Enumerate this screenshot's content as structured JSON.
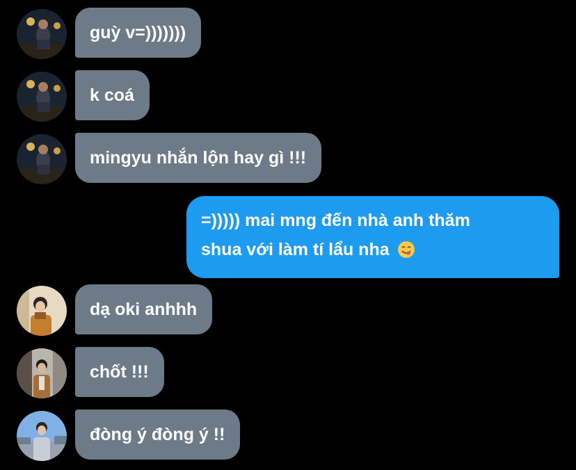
{
  "conversation": {
    "messages": [
      {
        "sender": "incoming",
        "avatar_icon": "avatar-night-photo-icon",
        "text": "guỳ v=)))))))"
      },
      {
        "sender": "incoming",
        "avatar_icon": "avatar-night-photo-icon",
        "text": "k coá"
      },
      {
        "sender": "incoming",
        "avatar_icon": "avatar-night-photo-icon",
        "text": "mingyu nhắn lộn hay gì !!!"
      },
      {
        "sender": "outgoing",
        "line1": "=))))) mai mng đến nhà anh thăm",
        "line2": "shua với làm tí lẩu nha",
        "emoji": "savoring-food-face-emoji"
      },
      {
        "sender": "incoming",
        "avatar_icon": "avatar-portrait-icon",
        "text": "dạ oki anhhh"
      },
      {
        "sender": "incoming",
        "avatar_icon": "avatar-street-icon",
        "text": "chốt !!!"
      },
      {
        "sender": "incoming",
        "avatar_icon": "avatar-outdoor-icon",
        "text": "đòng ý đòng ý !!"
      }
    ]
  },
  "colors": {
    "background": "#000000",
    "incoming_bubble": "#6d7a87",
    "outgoing_bubble": "#1d9bf0",
    "text": "#ffffff"
  }
}
